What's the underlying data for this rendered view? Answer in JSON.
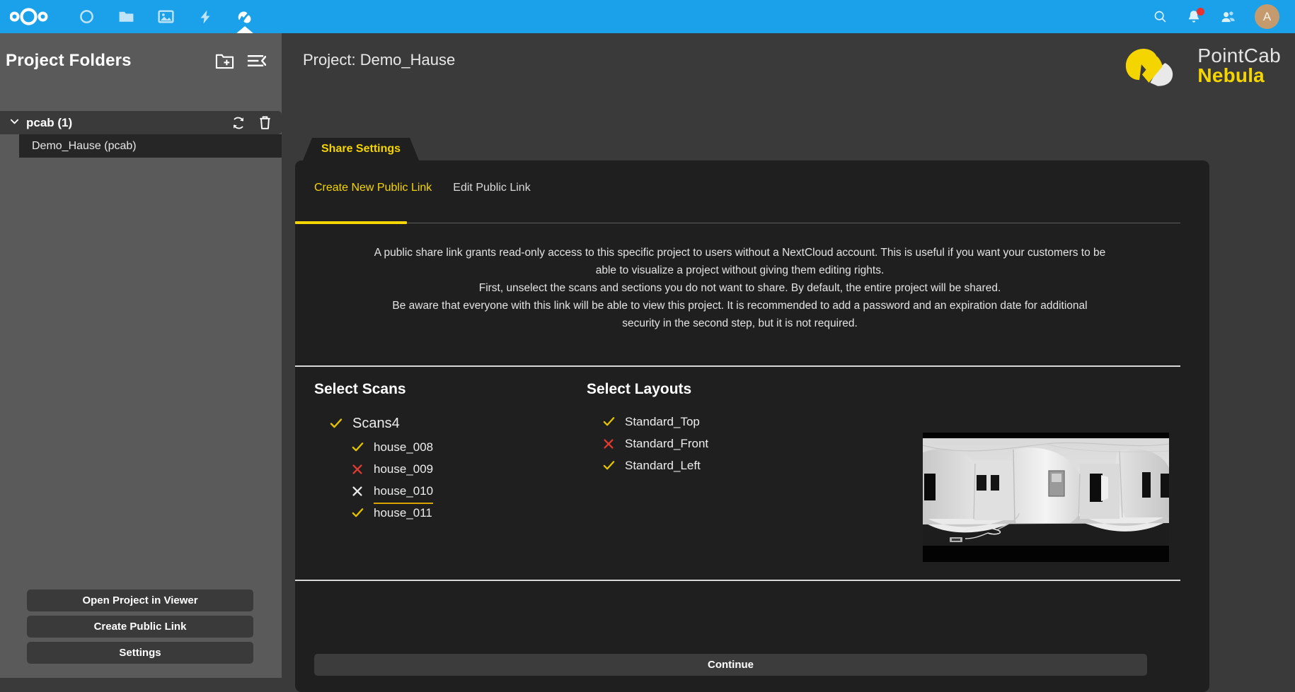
{
  "topbar": {
    "logo_name": "nextcloud-logo",
    "apps": [
      {
        "name": "dashboard-icon",
        "label": "Dashboard",
        "active": false
      },
      {
        "name": "files-icon",
        "label": "Files",
        "active": false
      },
      {
        "name": "photos-icon",
        "label": "Photos",
        "active": false
      },
      {
        "name": "activity-icon",
        "label": "Activity",
        "active": false
      },
      {
        "name": "pointcab-icon",
        "label": "PointCab Nebula",
        "active": true
      }
    ],
    "right": {
      "search_label": "Search",
      "notifications_label": "Notifications",
      "notification_badge": true,
      "contacts_label": "Contacts",
      "avatar_initial": "A"
    }
  },
  "sidebar": {
    "title": "Project Folders",
    "new_folder_label": "New project folder",
    "collapse_label": "Collapse sidebar",
    "tree": {
      "group_label": "pcab (1)",
      "refresh_label": "Refresh",
      "delete_label": "Delete",
      "children": [
        {
          "label": "Demo_Hause (pcab)"
        }
      ]
    },
    "buttons": [
      {
        "label": "Open Project in Viewer"
      },
      {
        "label": "Create Public Link"
      },
      {
        "label": "Settings"
      }
    ]
  },
  "main": {
    "project_title": "Project: Demo_Hause",
    "brand": {
      "line1": "PointCab",
      "line2": "Nebula"
    },
    "tab": {
      "label": "Share Settings"
    },
    "subtabs": [
      {
        "label": "Create New Public Link",
        "active": true
      },
      {
        "label": "Edit Public Link",
        "active": false
      }
    ],
    "description": [
      "A public share link grants read-only access to this specific project to users without a NextCloud account. This is useful if you want your customers to be able to visualize a project without giving them editing rights.",
      "First, unselect the scans and sections you do not want to share. By default, the entire project will be shared.",
      "Be aware that everyone with this link will be able to view this project. It is recommended to add a password and an expiration date for additional security in the second step, but it is not required."
    ],
    "scans": {
      "title": "Select Scans",
      "root": {
        "label": "Scans4",
        "state": "checked"
      },
      "items": [
        {
          "label": "house_008",
          "state": "checked"
        },
        {
          "label": "house_009",
          "state": "unchecked"
        },
        {
          "label": "house_010",
          "state": "hovered"
        },
        {
          "label": "house_011",
          "state": "checked"
        }
      ]
    },
    "layouts": {
      "title": "Select Layouts",
      "items": [
        {
          "label": "Standard_Top",
          "state": "checked"
        },
        {
          "label": "Standard_Front",
          "state": "unchecked"
        },
        {
          "label": "Standard_Left",
          "state": "checked"
        }
      ]
    },
    "preview": {
      "name": "panorama-scan-preview",
      "alt": "360 degree panoramic interior scan preview"
    },
    "continue_label": "Continue"
  },
  "colors": {
    "nextcloud_blue": "#1ba1e9",
    "accent_yellow": "#f5d500",
    "check_yellow": "#e8c400",
    "cross_red": "#e03b2f",
    "panel_bg": "#1f1f1f",
    "main_bg": "#3a3a3a",
    "sidebar_bg": "#5a5a5a",
    "avatar_bg": "#c59a6d",
    "notification_red": "#e9322d"
  }
}
